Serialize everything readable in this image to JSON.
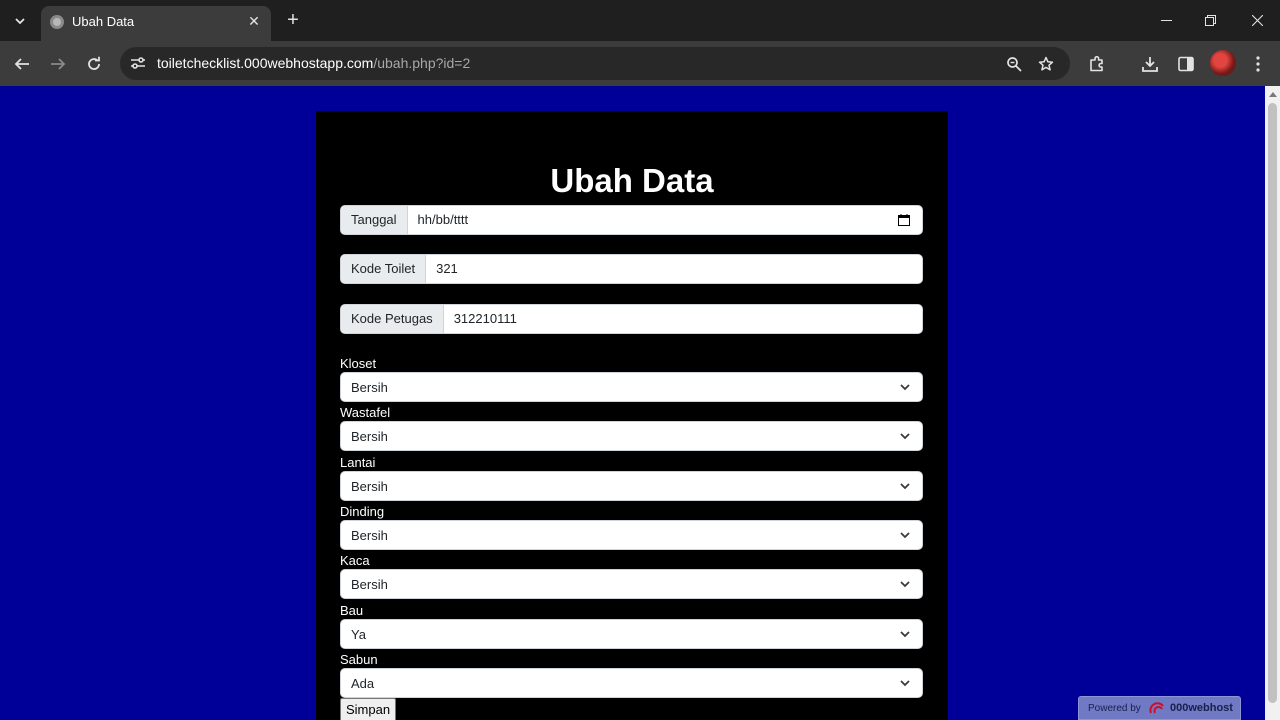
{
  "browser": {
    "tab_title": "Ubah Data",
    "url_host": "toiletchecklist.000webhostapp.com",
    "url_path": "/ubah.php?id=2"
  },
  "page": {
    "heading": "Ubah Data",
    "fields": {
      "tanggal": {
        "label": "Tanggal",
        "placeholder": "hh/bb/tttt"
      },
      "kode_toilet": {
        "label": "Kode Toilet",
        "value": "321"
      },
      "kode_petugas": {
        "label": "Kode Petugas",
        "value": "312210111"
      }
    },
    "selects": [
      {
        "label": "Kloset",
        "value": "Bersih"
      },
      {
        "label": "Wastafel",
        "value": "Bersih"
      },
      {
        "label": "Lantai",
        "value": "Bersih"
      },
      {
        "label": "Dinding",
        "value": "Bersih"
      },
      {
        "label": "Kaca",
        "value": "Bersih"
      },
      {
        "label": "Bau",
        "value": "Ya"
      },
      {
        "label": "Sabun",
        "value": "Ada"
      }
    ],
    "submit_label": "Simpan"
  },
  "hosting_badge": {
    "prefix": "Powered by",
    "brand": "000webhost"
  },
  "colors": {
    "page_background": "#000099",
    "card_background": "#000000"
  }
}
